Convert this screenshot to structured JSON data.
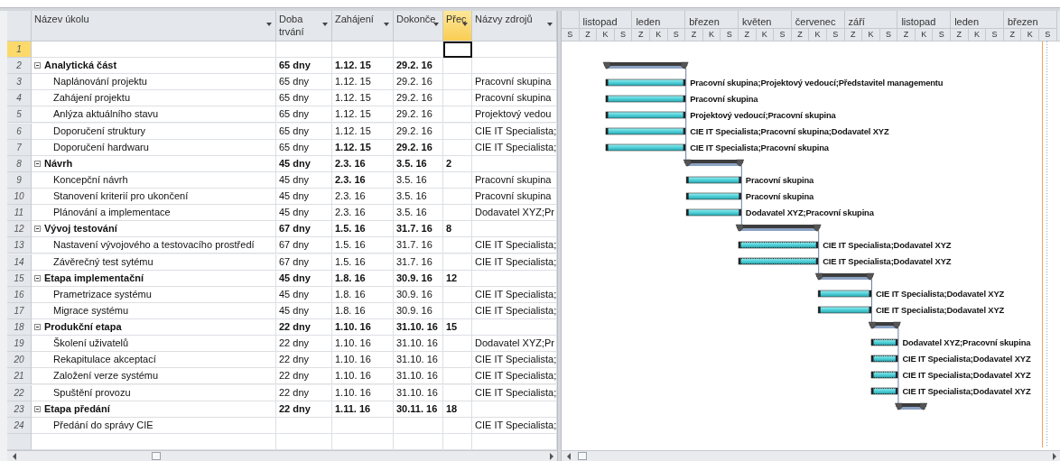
{
  "table": {
    "columns": [
      {
        "label": "Název úkolu",
        "selected": false
      },
      {
        "label": "Doba trvání",
        "selected": false
      },
      {
        "label": "Zahájení",
        "selected": false
      },
      {
        "label": "Dokonče",
        "selected": false
      },
      {
        "label": "Přec",
        "selected": true
      },
      {
        "label": "Názvy zdrojů",
        "selected": false
      }
    ],
    "rows": [
      {
        "number": "1",
        "kind": "empty",
        "selected": true
      },
      {
        "number": "2",
        "kind": "summary",
        "selected": false,
        "name": "Analytická část",
        "duration": "65 dny",
        "start": "1.12. 15",
        "finish": "29.2. 16",
        "start_bold": true,
        "finish_bold": true
      },
      {
        "number": "3",
        "kind": "task",
        "selected": false,
        "name": "Naplánování projektu",
        "duration": "65 dny",
        "start": "1.12. 15",
        "finish": "29.2. 16",
        "start_bold": false,
        "finish_bold": false,
        "resources": "Pracovní skupina",
        "dotted_bar": false,
        "bar_label": "Pracovní skupina;Projektový vedoucí;Představitel managementu"
      },
      {
        "number": "4",
        "kind": "task",
        "selected": false,
        "name": "Zahájení projektu",
        "duration": "65 dny",
        "start": "1.12. 15",
        "finish": "29.2. 16",
        "start_bold": false,
        "finish_bold": false,
        "resources": "Pracovní skupina",
        "dotted_bar": false,
        "bar_label": "Pracovní skupina"
      },
      {
        "number": "5",
        "kind": "task",
        "selected": false,
        "name": "Anlýza aktuálního stavu",
        "duration": "65 dny",
        "start": "1.12. 15",
        "finish": "29.2. 16",
        "start_bold": false,
        "finish_bold": false,
        "resources": "Projektový vedou",
        "dotted_bar": false,
        "bar_label": "Projektový vedoucí;Pracovní skupina"
      },
      {
        "number": "6",
        "kind": "task",
        "selected": false,
        "name": "Doporučení struktury",
        "duration": "65 dny",
        "start": "1.12. 15",
        "finish": "29.2. 16",
        "start_bold": false,
        "finish_bold": false,
        "resources": "CIE IT Specialista;",
        "dotted_bar": false,
        "bar_label": "CIE IT Specialista;Pracovní skupina;Dodavatel XYZ"
      },
      {
        "number": "7",
        "kind": "task",
        "selected": false,
        "name": "Doporučení hardwaru",
        "duration": "65 dny",
        "start": "1.12. 15",
        "finish": "29.2. 16",
        "start_bold": true,
        "finish_bold": true,
        "resources": "CIE IT Specialista;",
        "dotted_bar": false,
        "bar_label": "CIE IT Specialista;Pracovní skupina"
      },
      {
        "number": "8",
        "kind": "summary",
        "selected": false,
        "name": "Návrh",
        "duration": "45 dny",
        "start": "2.3. 16",
        "finish": "3.5. 16",
        "predecessors": "2",
        "start_bold": true,
        "finish_bold": true
      },
      {
        "number": "9",
        "kind": "task",
        "selected": false,
        "name": "Koncepční návrh",
        "duration": "45 dny",
        "start": "2.3. 16",
        "finish": "3.5. 16",
        "start_bold": true,
        "finish_bold": false,
        "resources": "Pracovní skupina",
        "dotted_bar": false,
        "bar_label": "Pracovní skupina"
      },
      {
        "number": "10",
        "kind": "task",
        "selected": false,
        "name": "Stanovení kriterií pro ukončení",
        "duration": "45 dny",
        "start": "2.3. 16",
        "finish": "3.5. 16",
        "start_bold": false,
        "finish_bold": false,
        "resources": "Pracovní skupina",
        "dotted_bar": false,
        "bar_label": "Pracovní skupina"
      },
      {
        "number": "11",
        "kind": "task",
        "selected": false,
        "name": "Plánování a implementace",
        "duration": "45 dny",
        "start": "2.3. 16",
        "finish": "3.5. 16",
        "start_bold": false,
        "finish_bold": false,
        "resources": "Dodavatel XYZ;Pr",
        "dotted_bar": false,
        "bar_label": "Dodavatel XYZ;Pracovní skupina"
      },
      {
        "number": "12",
        "kind": "summary",
        "selected": false,
        "name": "Vývoj  testování",
        "duration": "67 dny",
        "start": "1.5. 16",
        "finish": "31.7. 16",
        "predecessors": "8",
        "start_bold": true,
        "finish_bold": true
      },
      {
        "number": "13",
        "kind": "task",
        "selected": false,
        "name": "Nastavení vývojového a testovacího prostředí",
        "duration": "67 dny",
        "start": "1.5. 16",
        "finish": "31.7. 16",
        "start_bold": false,
        "finish_bold": false,
        "resources": "CIE IT Specialista;",
        "dotted_bar": true,
        "bar_label": "CIE IT Specialista;Dodavatel XYZ"
      },
      {
        "number": "14",
        "kind": "task",
        "selected": false,
        "name": "Závěrečný test sytému",
        "duration": "67 dny",
        "start": "1.5. 16",
        "finish": "31.7. 16",
        "start_bold": false,
        "finish_bold": false,
        "resources": "CIE IT Specialista;",
        "dotted_bar": true,
        "bar_label": "CIE IT Specialista;Dodavatel XYZ"
      },
      {
        "number": "15",
        "kind": "summary",
        "selected": false,
        "name": "Etapa implementační",
        "duration": "45 dny",
        "start": "1.8. 16",
        "finish": "30.9. 16",
        "predecessors": "12",
        "start_bold": true,
        "finish_bold": true
      },
      {
        "number": "16",
        "kind": "task",
        "selected": false,
        "name": "Prametrizace systému",
        "duration": "45 dny",
        "start": "1.8. 16",
        "finish": "30.9. 16",
        "start_bold": false,
        "finish_bold": false,
        "resources": "CIE IT Specialista;",
        "dotted_bar": false,
        "bar_label": "CIE IT Specialista;Dodavatel XYZ"
      },
      {
        "number": "17",
        "kind": "task",
        "selected": false,
        "name": "Migrace systému",
        "duration": "45 dny",
        "start": "1.8. 16",
        "finish": "30.9. 16",
        "start_bold": false,
        "finish_bold": false,
        "resources": "CIE IT Specialista;",
        "dotted_bar": false,
        "bar_label": "CIE IT Specialista;Dodavatel XYZ"
      },
      {
        "number": "18",
        "kind": "summary",
        "selected": false,
        "name": "Produkční etapa",
        "duration": "22 dny",
        "start": "1.10. 16",
        "finish": "31.10. 16",
        "predecessors": "15",
        "start_bold": true,
        "finish_bold": true
      },
      {
        "number": "19",
        "kind": "task",
        "selected": false,
        "name": "Školení uživatelů",
        "duration": "22 dny",
        "start": "1.10. 16",
        "finish": "31.10. 16",
        "start_bold": false,
        "finish_bold": false,
        "resources": "Dodavatel XYZ;Pr",
        "dotted_bar": true,
        "bar_label": "Dodavatel XYZ;Pracovní skupina"
      },
      {
        "number": "20",
        "kind": "task",
        "selected": false,
        "name": "Rekapitulace akceptací",
        "duration": "22 dny",
        "start": "1.10. 16",
        "finish": "31.10. 16",
        "start_bold": false,
        "finish_bold": false,
        "resources": "CIE IT Specialista;",
        "dotted_bar": true,
        "bar_label": "CIE IT Specialista;Dodavatel XYZ"
      },
      {
        "number": "21",
        "kind": "task",
        "selected": false,
        "name": "Založení verze systému",
        "duration": "22 dny",
        "start": "1.10. 16",
        "finish": "31.10. 16",
        "start_bold": false,
        "finish_bold": false,
        "resources": "CIE IT Specialista;",
        "dotted_bar": true,
        "bar_label": "CIE IT Specialista;Dodavatel XYZ"
      },
      {
        "number": "22",
        "kind": "task",
        "selected": false,
        "name": "Spuštění provozu",
        "duration": "22 dny",
        "start": "1.10. 16",
        "finish": "31.10. 16",
        "start_bold": false,
        "finish_bold": false,
        "resources": "CIE IT Specialista;",
        "dotted_bar": true,
        "bar_label": "CIE IT Specialista;Dodavatel XYZ"
      },
      {
        "number": "23",
        "kind": "summary",
        "selected": false,
        "name": "Etapa předání",
        "duration": "22 dny",
        "start": "1.11. 16",
        "finish": "30.11. 16",
        "predecessors": "18",
        "start_bold": true,
        "finish_bold": true
      },
      {
        "number": "24",
        "kind": "task",
        "selected": false,
        "name": "Předání do správy CIE",
        "resources": "CIE IT Specialista;"
      }
    ]
  },
  "timescale": {
    "months": [
      "listopad",
      "leden",
      "březen",
      "květen",
      "červenec",
      "září",
      "listopad",
      "leden",
      "březen"
    ],
    "units": [
      "S",
      "Z",
      "K",
      "S",
      "Z",
      "K",
      "S",
      "Z",
      "K",
      "S",
      "Z",
      "K",
      "S",
      "Z",
      "K",
      "S",
      "Z",
      "K",
      "S",
      "Z",
      "K",
      "S",
      "Z",
      "K",
      "S",
      "Z",
      "K",
      "S"
    ]
  }
}
